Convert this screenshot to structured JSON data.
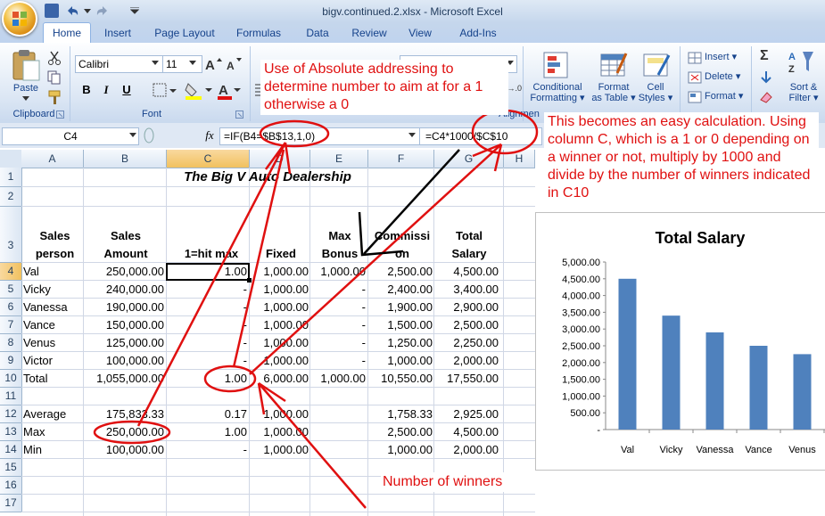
{
  "window": {
    "title": "bigv.continued.2.xlsx - Microsoft Excel"
  },
  "tabs": [
    "Home",
    "Insert",
    "Page Layout",
    "Formulas",
    "Data",
    "Review",
    "View",
    "Add-Ins"
  ],
  "ribbon": {
    "paste_label": "Paste",
    "font_name": "Calibri",
    "font_size": "11",
    "bold": "B",
    "italic": "I",
    "underline": "U",
    "clipboard_label": "Clipboard",
    "font_label": "Font",
    "alignment_label": "Alignmen",
    "conditional_formatting": [
      "Conditional",
      "Formatting"
    ],
    "format_as_table": [
      "Format",
      "as Table"
    ],
    "cell_styles": [
      "Cell",
      "Styles"
    ],
    "insert": "Insert",
    "delete": "Delete",
    "format": "Format",
    "sort_filter": [
      "Sort &",
      "Filter"
    ],
    "decimal_label": ".00→.0"
  },
  "formula_bar": {
    "name_box": "C4",
    "fx": "fx",
    "formula": "=IF(B4=$B$13,1,0)",
    "formula_overlay": "=C4*1000/$C$10"
  },
  "grid": {
    "columns": [
      "A",
      "B",
      "C",
      "D",
      "E",
      "F",
      "G",
      "H"
    ],
    "rows": [
      "1",
      "2",
      "3",
      "4",
      "5",
      "6",
      "7",
      "8",
      "9",
      "10",
      "11",
      "12",
      "13",
      "14",
      "15",
      "16",
      "17"
    ],
    "title": "The Big V Auto Dealership",
    "headers": {
      "a": [
        "Sales",
        "person"
      ],
      "b": [
        "Sales",
        "Amount"
      ],
      "c": "1=hit max",
      "d": "Fixed",
      "e": [
        "Max",
        "Bonus"
      ],
      "f": [
        "Commissi",
        "on"
      ],
      "g": [
        "Total",
        "Salary"
      ]
    },
    "data": [
      [
        "Val",
        "250,000.00",
        "1.00",
        "1,000.00",
        "1,000.00",
        "2,500.00",
        "4,500.00"
      ],
      [
        "Vicky",
        "240,000.00",
        "-",
        "1,000.00",
        "-",
        "2,400.00",
        "3,400.00"
      ],
      [
        "Vanessa",
        "190,000.00",
        "-",
        "1,000.00",
        "-",
        "1,900.00",
        "2,900.00"
      ],
      [
        "Vance",
        "150,000.00",
        "-",
        "1,000.00",
        "-",
        "1,500.00",
        "2,500.00"
      ],
      [
        "Venus",
        "125,000.00",
        "-",
        "1,000.00",
        "-",
        "1,250.00",
        "2,250.00"
      ],
      [
        "Victor",
        "100,000.00",
        "-",
        "1,000.00",
        "-",
        "1,000.00",
        "2,000.00"
      ],
      [
        "Total",
        "1,055,000.00",
        "1.00",
        "6,000.00",
        "1,000.00",
        "10,550.00",
        "17,550.00"
      ]
    ],
    "stats": [
      [
        "Average",
        "175,833.33",
        "0.17",
        "1,000.00",
        "",
        "1,758.33",
        "2,925.00"
      ],
      [
        "Max",
        "250,000.00",
        "1.00",
        "1,000.00",
        "",
        "2,500.00",
        "4,500.00"
      ],
      [
        "Min",
        "100,000.00",
        "-",
        "1,000.00",
        "",
        "1,000.00",
        "2,000.00"
      ]
    ]
  },
  "annotations": {
    "absolute": "Use of Absolute addressing to determine number to aim at for a 1 otherwise a 0",
    "easy_calc": "This becomes an easy calculation. Using column C, which is a 1 or 0 depending on a winner or not, multiply by 1000 and divide by the number of winners indicated in C10",
    "winners": "Number of winners"
  },
  "chart_data": {
    "type": "bar",
    "title": "Total Salary",
    "categories": [
      "Val",
      "Vicky",
      "Vanessa",
      "Vance",
      "Venus"
    ],
    "values": [
      4500,
      3400,
      2900,
      2500,
      2250
    ],
    "ylim": [
      0,
      5000
    ],
    "yticks": [
      "5,000.00",
      "4,500.00",
      "4,000.00",
      "3,500.00",
      "3,000.00",
      "2,500.00",
      "2,000.00",
      "1,500.00",
      "1,000.00",
      "500.00",
      "-"
    ],
    "bar_color": "#4f81bd"
  },
  "colors": {
    "annotation": "#e01010",
    "selection": "#f1c15f",
    "excel_blue": "#15428b"
  }
}
